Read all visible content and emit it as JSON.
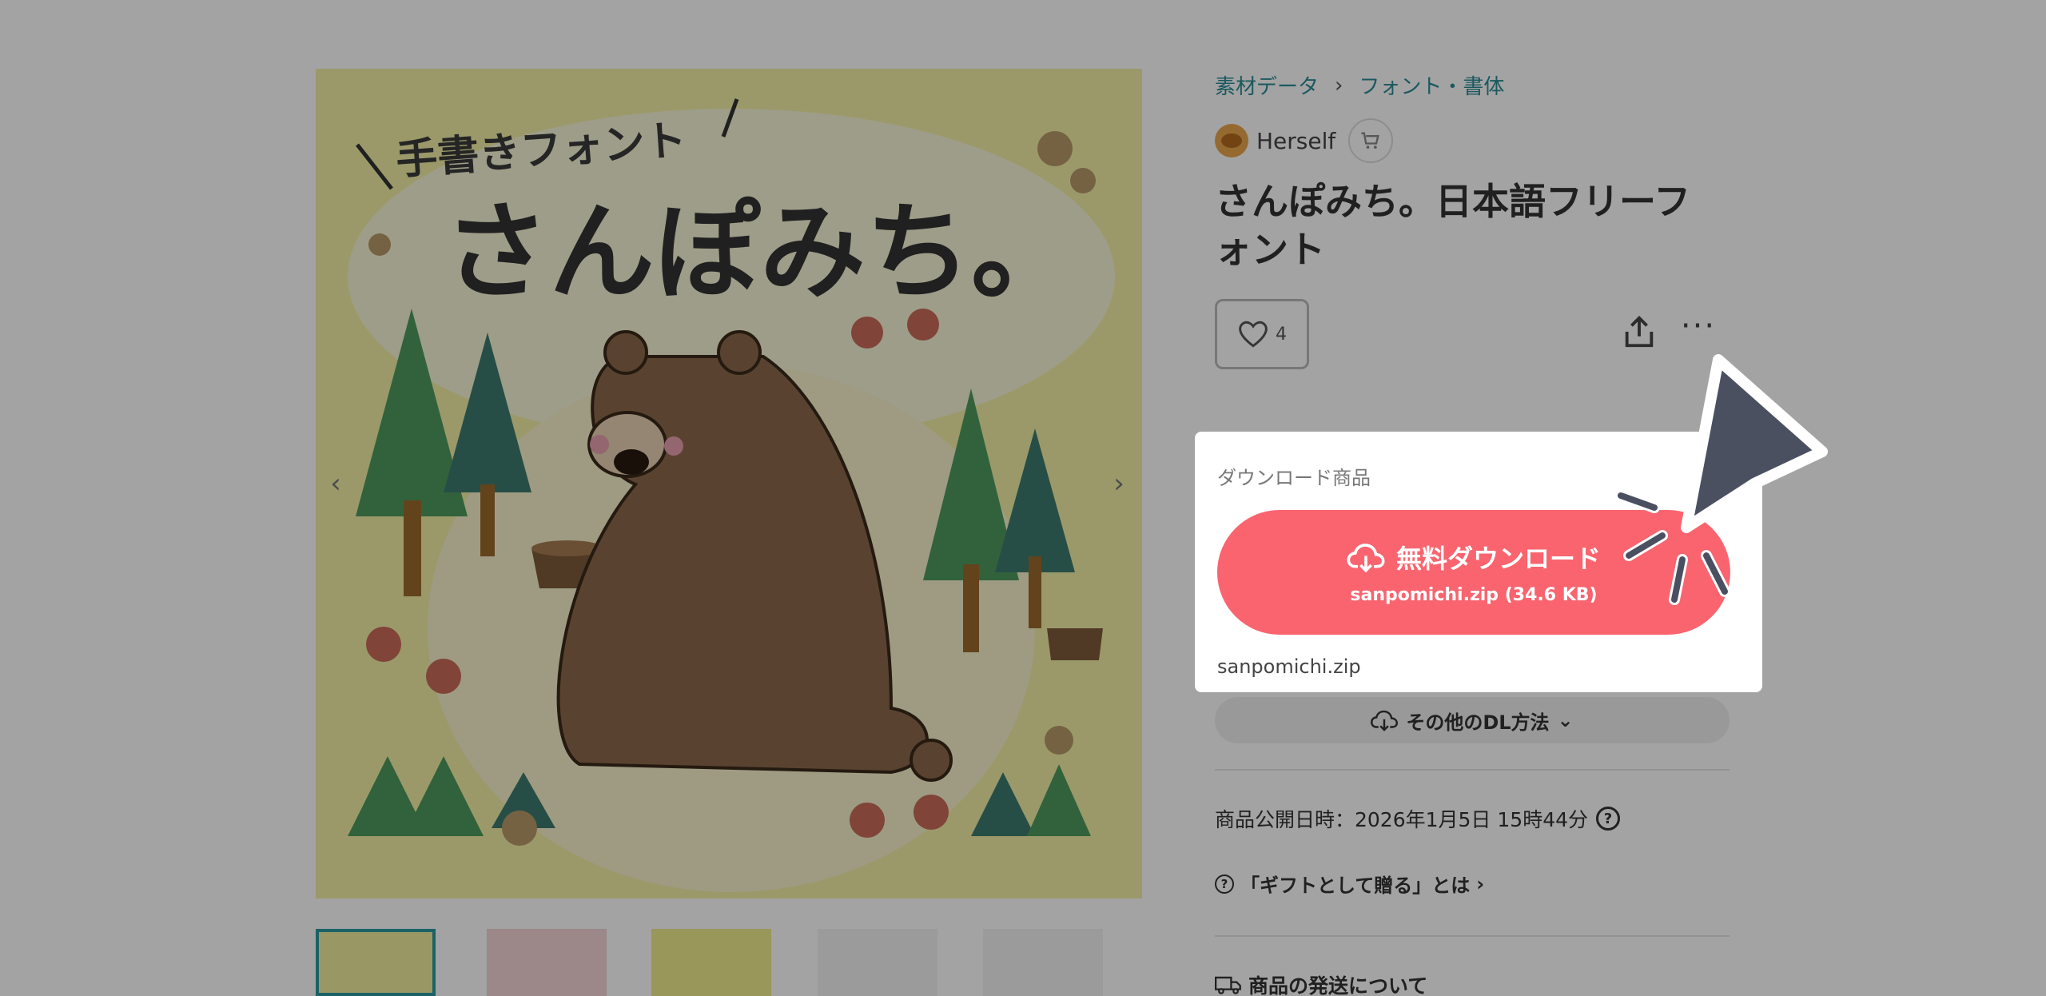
{
  "breadcrumb": {
    "category": "素材データ",
    "subcategory": "フォント・書体"
  },
  "shop": {
    "name": "Herself"
  },
  "product": {
    "title": "さんぽみち。日本語フリーフォント",
    "like_count": "4"
  },
  "hero": {
    "tagline": "手書きフォント",
    "headline": "さんぽみち。"
  },
  "download": {
    "heading": "ダウンロード商品",
    "button_label": "無料ダウンロード",
    "file_info": "sanpomichi.zip (34.6 KB)",
    "filename": "sanpomichi.zip",
    "other_methods": "その他のDL方法"
  },
  "meta": {
    "publish_label": "商品公開日時：2026年1月5日 15時44分",
    "gift_link": "「ギフトとして贈る」とは",
    "shipping": "商品の発送について"
  },
  "colors": {
    "accent": "#f9646f",
    "breadcrumb": "#2b8c95",
    "cursor": "#4a5060"
  }
}
